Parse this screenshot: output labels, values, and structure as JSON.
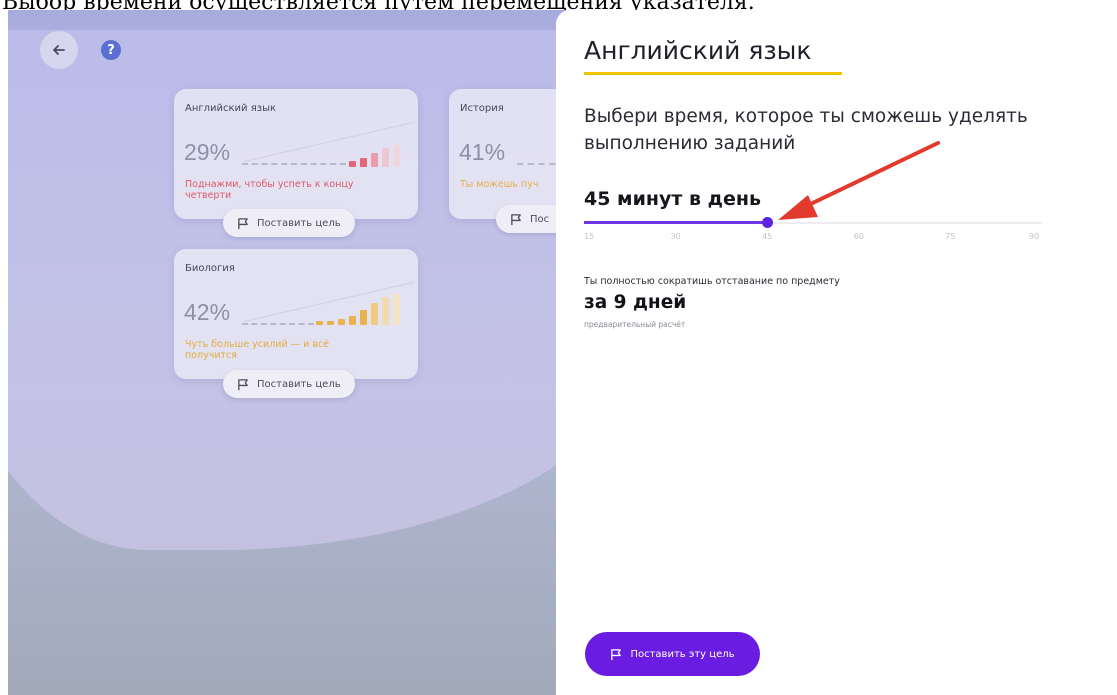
{
  "caption": "Выбор времени осуществляется путём перемещения указателя.",
  "top_bar": {
    "back_icon": "arrow-left-icon",
    "help_icon": "question-icon",
    "help_glyph": "?"
  },
  "subject_cards": [
    {
      "title": "Английский язык",
      "percent": "29%",
      "note": "Поднажми, чтобы успеть к концу четверти",
      "note_color": "#de5a68",
      "bar_color": "#e0687a",
      "goal_label": "Поставить цель"
    },
    {
      "title": "История",
      "percent": "41%",
      "note": "Ты можешь пуч",
      "note_color": "#e6b04a",
      "bar_color": "#eab24c",
      "goal_label": "Пос"
    },
    {
      "title": "Биология",
      "percent": "42%",
      "note": "Чуть больше усилий — и всё получится",
      "note_color": "#e3ac3c",
      "bar_color": "#eab24c",
      "goal_label": "Поставить цель"
    }
  ],
  "panel": {
    "title": "Английский язык",
    "question": "Выбери время, которое ты сможешь уделять выполнению заданий",
    "selected_label": "45 минут в день",
    "slider": {
      "min": 15,
      "max": 90,
      "value": 45,
      "ticks": [
        "15",
        "30",
        "45",
        "60",
        "75",
        "90"
      ]
    },
    "lag_text": "Ты полностью сократишь отставание по предмету",
    "lag_days": "за 9 дней",
    "lag_note": "предварительный расчёт",
    "cta_label": "Поставить эту цель",
    "cta_icon": "flag-icon"
  },
  "colors": {
    "accent": "#6a1de0",
    "title_underline": "#f2c400",
    "annotation_arrow": "#e23b2e"
  }
}
